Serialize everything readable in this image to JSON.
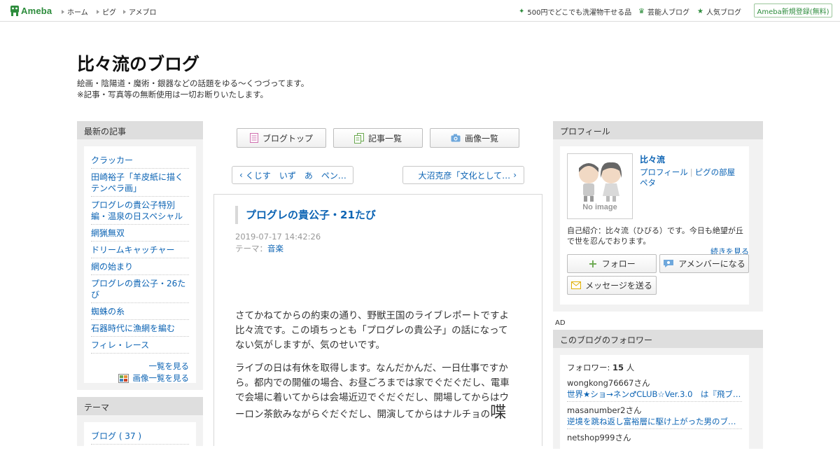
{
  "topbar": {
    "logo_text": "Ameba",
    "nav": [
      {
        "label": "ホーム"
      },
      {
        "label": "ピグ"
      },
      {
        "label": "アメブロ"
      }
    ],
    "right_links": [
      {
        "icon": "sparkle-icon",
        "label": "500円でどこでも洗濯物干せる品"
      },
      {
        "icon": "crown-icon",
        "label": "芸能人ブログ"
      },
      {
        "icon": "star-icon",
        "label": "人気ブログ"
      }
    ],
    "register_label": "Ameba新規登録(無料)",
    "colors": {
      "brand_green": "#2d8c3c",
      "link_blue": "#0d64b4"
    }
  },
  "blog": {
    "title": "比々流のブログ",
    "desc_line1": "絵画・陰陽道・魔術・銀器などの話題をゆる～くつづってます。",
    "desc_line2": "※記事・写真等の無断使用は一切お断りいたします。"
  },
  "sidebar_left": {
    "recent_heading": "最新の記事",
    "recent_items": [
      {
        "label": "クラッカー"
      },
      {
        "label": "田崎裕子「羊皮紙に描くテンペラ画」"
      },
      {
        "label": "プログレの貴公子特別編・温泉の日スペシャル"
      },
      {
        "label": "網猟無双"
      },
      {
        "label": "ドリームキャッチャー"
      },
      {
        "label": "網の始まり"
      },
      {
        "label": "プログレの貴公子・26たび"
      },
      {
        "label": "蜘蛛の糸"
      },
      {
        "label": "石器時代に漁網を編む"
      },
      {
        "label": "フィレ・レース"
      }
    ],
    "list_more": "一覧を見る",
    "image_list_more": "画像一覧を見る",
    "theme_heading": "テーマ",
    "theme_items": [
      {
        "label": "ブログ ( 37 )"
      }
    ]
  },
  "center": {
    "nav_buttons": {
      "top": "ブログトップ",
      "articles": "記事一覧",
      "images": "画像一覧"
    },
    "prev_label": "くじす　いず　あ　ペン…",
    "next_label": "大沼克彦「文化として…",
    "article": {
      "title": "プログレの貴公子・21たび",
      "date": "2019-07-17 14:42:26",
      "theme_prefix": "テーマ：",
      "theme_link": "音楽",
      "body_p1_l1": "さてかねてからの約束の通り、野獣王国のライブレポートですよ",
      "body_p1_l2": "比々流です。この頃ちっとも「プログレの貴公子」の話になって",
      "body_p1_l3": "ない気がしますが、気のせいです。",
      "body_p2_l1": "ライブの日は有休を取得します。なんだかんだ、一日仕事ですか",
      "body_p2_l2": "ら。都内での開催の場合、お昼ごろまでは家でぐだぐだし、電車",
      "body_p2_l3": "で会場に着いてからは会場近辺でぐだぐだし、開場してからはウ",
      "body_p2_l4": "ーロン茶飲みながらぐだぐだし、開演してからはナルチョの",
      "body_p2_big": "喋"
    }
  },
  "sidebar_right": {
    "profile_heading": "プロフィール",
    "noimage_label": "No image",
    "profile_name": "比々流",
    "profile_link1": "プロフィール",
    "profile_link2": "ピグの部屋",
    "profile_link3": "ペタ",
    "profile_intro": "自己紹介：比々流（ひびる）です。今日も絶望が丘で世を忍んでおります。",
    "profile_more": "続きを見る",
    "follow_label": "フォロー",
    "amember_label": "アメンバーになる",
    "message_label": "メッセージを送る",
    "ad_label": "AD",
    "followers_heading": "このブログのフォロワー",
    "followers_count_prefix": "フォロワー:",
    "followers_count": "15",
    "followers_count_suffix": "人",
    "followers": [
      {
        "user": "wongkong76667さん",
        "blog": "世界★ショ→ネン♂CLUB☆Ver.3.0　は『飛ブ…"
      },
      {
        "user": "masanumber2さん",
        "blog": "逆境を跳ね返し富裕層に駆け上がった男のブ…"
      },
      {
        "user": "netshop999さん",
        "blog": ""
      }
    ]
  }
}
